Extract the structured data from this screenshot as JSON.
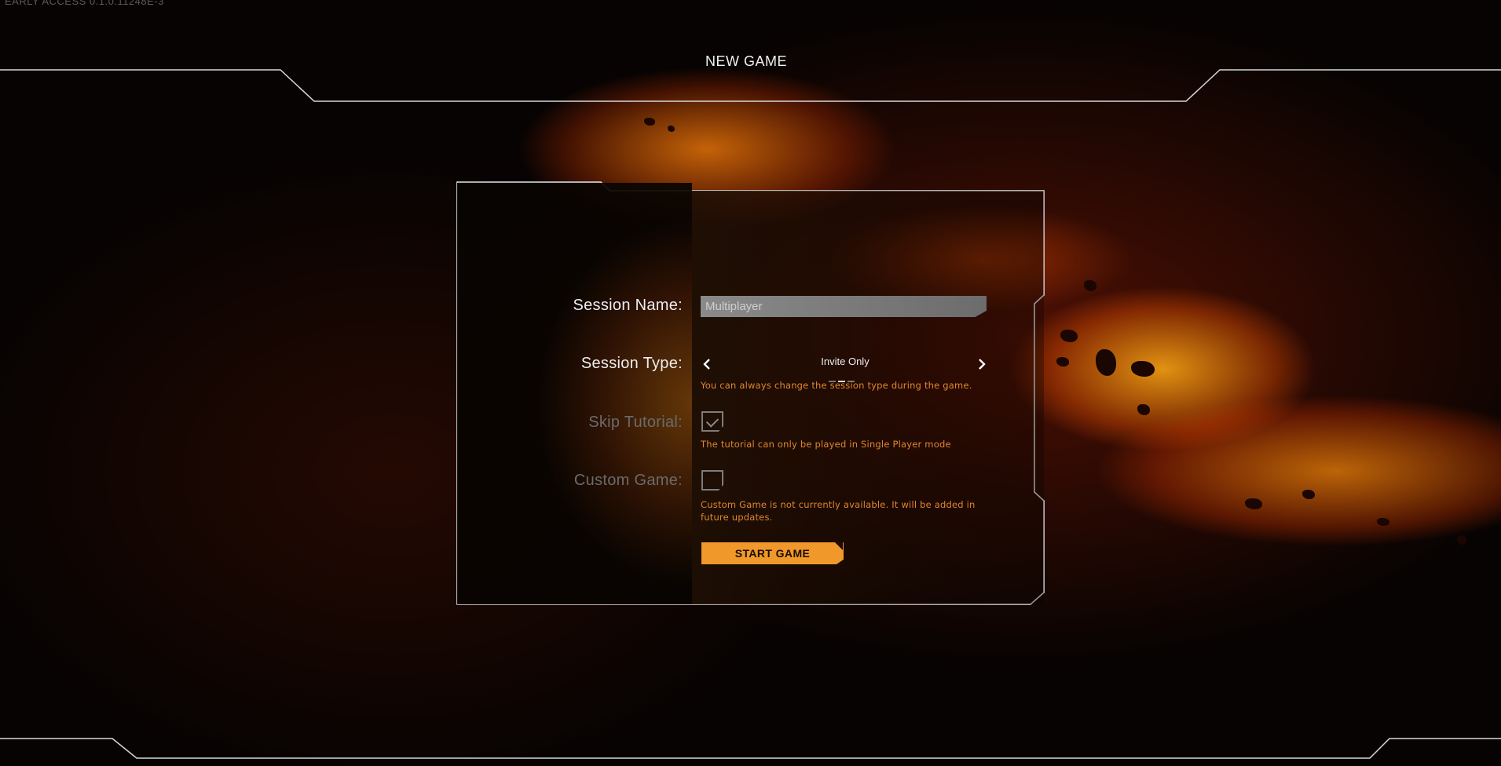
{
  "version_label": "EARLY ACCESS 0.1.0.11248E-3",
  "screen_title": "NEW GAME",
  "form": {
    "session_name": {
      "label": "Session Name:",
      "value": "Multiplayer"
    },
    "session_type": {
      "label": "Session Type:",
      "value": "Invite Only",
      "prev_icon": "chevron-left-icon",
      "next_icon": "chevron-right-icon",
      "hint": "You can always change the session type during the game."
    },
    "skip_tutorial": {
      "label": "Skip Tutorial:",
      "checked": true,
      "enabled": false,
      "hint": "The tutorial can only be played in Single Player mode"
    },
    "custom_game": {
      "label": "Custom Game:",
      "checked": false,
      "enabled": false,
      "hint_line1": "Custom Game is not currently available. It will be added in",
      "hint_line2": "future updates."
    },
    "start_button": "START GAME"
  },
  "colors": {
    "accent": "#f0982a",
    "hint_text": "#e0862e",
    "label_active": "#eeeeee",
    "label_disabled": "#6b6b6b",
    "frame_line": "#d8d8d8"
  }
}
